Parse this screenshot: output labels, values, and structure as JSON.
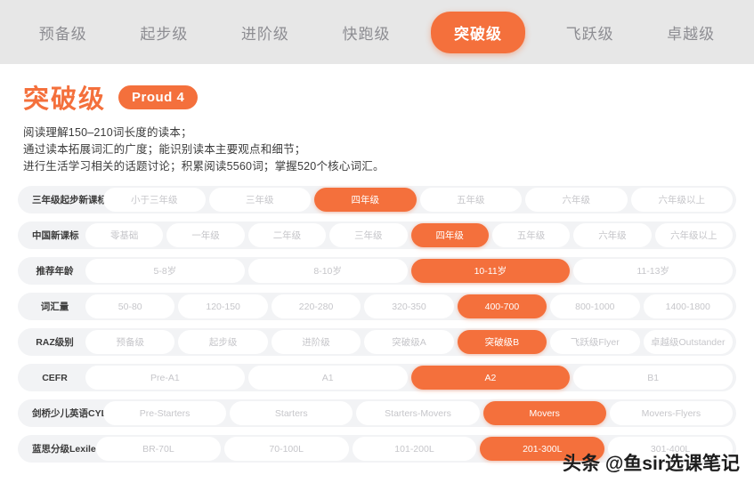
{
  "tabs": [
    {
      "label": "预备级",
      "active": false
    },
    {
      "label": "起步级",
      "active": false
    },
    {
      "label": "进阶级",
      "active": false
    },
    {
      "label": "快跑级",
      "active": false
    },
    {
      "label": "突破级",
      "active": true
    },
    {
      "label": "飞跃级",
      "active": false
    },
    {
      "label": "卓越级",
      "active": false
    }
  ],
  "header": {
    "title": "突破级",
    "badge": "Proud 4"
  },
  "description": [
    "阅读理解150–210词长度的读本；",
    "通过读本拓展词汇的广度；能识别读本主要观点和细节；",
    "进行生活学习相关的话题讨论；积累阅读5560词；掌握520个核心词汇。"
  ],
  "rows": [
    {
      "label": "三年级起步新课标",
      "label_width": 92,
      "options": [
        {
          "text": "小于三年级",
          "active": false
        },
        {
          "text": "三年级",
          "active": false
        },
        {
          "text": "四年级",
          "active": true
        },
        {
          "text": "五年级",
          "active": false
        },
        {
          "text": "六年级",
          "active": false
        },
        {
          "text": "六年级以上",
          "active": false
        }
      ]
    },
    {
      "label": "中国新课标",
      "label_width": 72,
      "options": [
        {
          "text": "零基础",
          "active": false
        },
        {
          "text": "一年级",
          "active": false
        },
        {
          "text": "二年级",
          "active": false
        },
        {
          "text": "三年级",
          "active": false
        },
        {
          "text": "四年级",
          "active": true
        },
        {
          "text": "五年级",
          "active": false
        },
        {
          "text": "六年级",
          "active": false
        },
        {
          "text": "六年级以上",
          "active": false
        }
      ]
    },
    {
      "label": "推荐年龄",
      "label_width": 72,
      "options": [
        {
          "text": "5-8岁",
          "active": false
        },
        {
          "text": "8-10岁",
          "active": false
        },
        {
          "text": "10-11岁",
          "active": true
        },
        {
          "text": "11-13岁",
          "active": false
        }
      ]
    },
    {
      "label": "词汇量",
      "label_width": 72,
      "options": [
        {
          "text": "50-80",
          "active": false
        },
        {
          "text": "120-150",
          "active": false
        },
        {
          "text": "220-280",
          "active": false
        },
        {
          "text": "320-350",
          "active": false
        },
        {
          "text": "400-700",
          "active": true
        },
        {
          "text": "800-1000",
          "active": false
        },
        {
          "text": "1400-1800",
          "active": false
        }
      ]
    },
    {
      "label": "RAZ级别",
      "label_width": 72,
      "options": [
        {
          "text": "预备级",
          "active": false
        },
        {
          "text": "起步级",
          "active": false
        },
        {
          "text": "进阶级",
          "active": false
        },
        {
          "text": "突破级A",
          "active": false
        },
        {
          "text": "突破级B",
          "active": true
        },
        {
          "text": "飞跃级Flyer",
          "active": false
        },
        {
          "text": "卓越级Outstander",
          "active": false
        }
      ]
    },
    {
      "label": "CEFR",
      "label_width": 72,
      "options": [
        {
          "text": "Pre-A1",
          "active": false
        },
        {
          "text": "A1",
          "active": false
        },
        {
          "text": "A2",
          "active": true
        },
        {
          "text": "B1",
          "active": false
        }
      ]
    },
    {
      "label": "剑桥少儿英语CYLE",
      "label_width": 92,
      "options": [
        {
          "text": "Pre-Starters",
          "active": false
        },
        {
          "text": "Starters",
          "active": false
        },
        {
          "text": "Starters-Movers",
          "active": false
        },
        {
          "text": "Movers",
          "active": true
        },
        {
          "text": "Movers-Flyers",
          "active": false
        }
      ]
    },
    {
      "label": "蓝思分级Lexile",
      "label_width": 84,
      "options": [
        {
          "text": "BR-70L",
          "active": false
        },
        {
          "text": "70-100L",
          "active": false
        },
        {
          "text": "101-200L",
          "active": false
        },
        {
          "text": "201-300L",
          "active": true
        },
        {
          "text": "301-400L",
          "active": false
        }
      ]
    }
  ],
  "watermark": "头条 @鱼sir选课笔记",
  "colors": {
    "accent": "#f4703c",
    "tabbar_bg": "#e7e7e7",
    "row_track": "#f2f3f5",
    "option_text": "#c6c6ca"
  }
}
